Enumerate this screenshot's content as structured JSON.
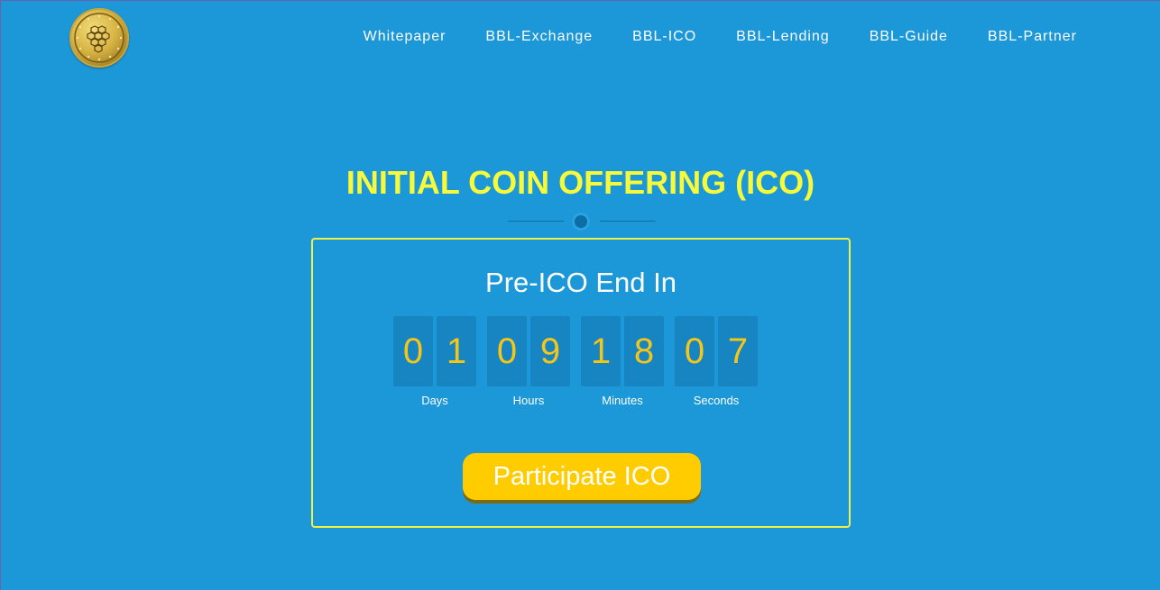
{
  "nav": {
    "items": [
      {
        "label": "Whitepaper"
      },
      {
        "label": "BBL-Exchange"
      },
      {
        "label": "BBL-ICO"
      },
      {
        "label": "BBL-Lending"
      },
      {
        "label": "BBL-Guide"
      },
      {
        "label": "BBL-Partner"
      }
    ]
  },
  "logo": {
    "icon": "coin-logo-icon"
  },
  "hero": {
    "title": "INITIAL COIN OFFERING (ICO)"
  },
  "countdown": {
    "heading": "Pre-ICO End In",
    "units": [
      {
        "digits": [
          "0",
          "1"
        ],
        "label": "Days"
      },
      {
        "digits": [
          "0",
          "9"
        ],
        "label": "Hours"
      },
      {
        "digits": [
          "1",
          "8"
        ],
        "label": "Minutes"
      },
      {
        "digits": [
          "0",
          "7"
        ],
        "label": "Seconds"
      }
    ]
  },
  "cta": {
    "label": "Participate ICO"
  },
  "colors": {
    "background": "#1c98d8",
    "title": "#f7fa3a",
    "digit": "#f5c518",
    "button": "#ffcc00",
    "box_border": "#f0f04a"
  }
}
